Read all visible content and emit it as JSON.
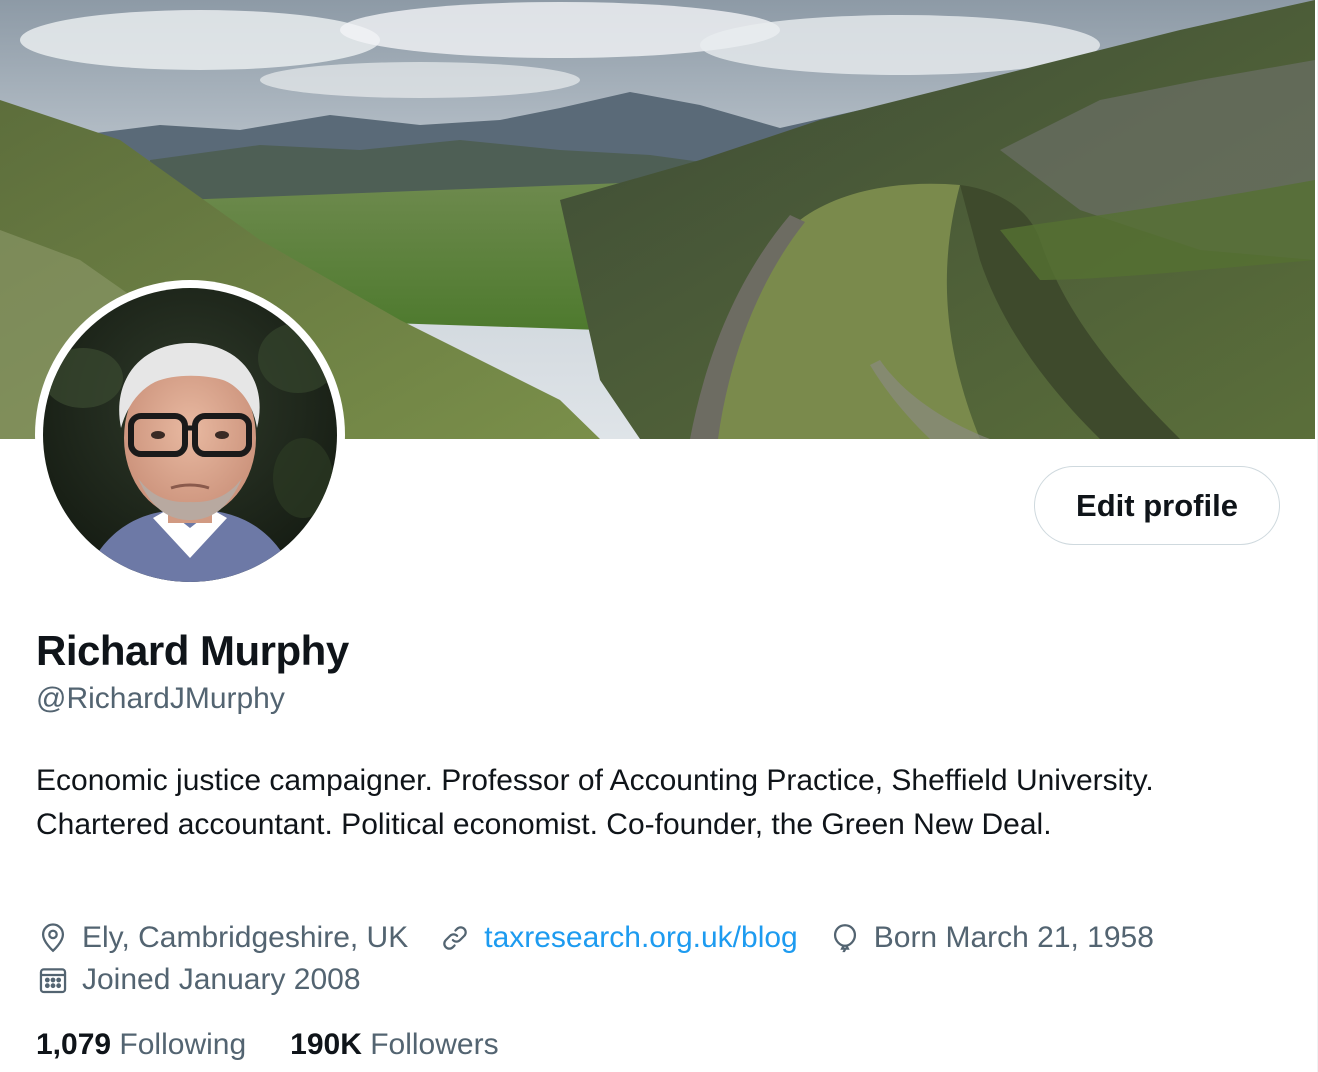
{
  "profile": {
    "name": "Richard Murphy",
    "handle": "@RichardJMurphy",
    "bio": "Economic justice campaigner. Professor of Accounting Practice, Sheffield University. Chartered accountant. Political economist. Co-founder, the Green New Deal.",
    "edit_label": "Edit profile"
  },
  "meta": {
    "location": "Ely, Cambridgeshire, UK",
    "website": "taxresearch.org.uk/blog",
    "birthday": "Born March 21, 1958",
    "joined": "Joined January 2008"
  },
  "stats": {
    "following_count": "1,079",
    "following_label": "Following",
    "followers_count": "190K",
    "followers_label": "Followers"
  },
  "icons": {
    "location": "location-pin-icon",
    "website": "link-icon",
    "birthday": "balloon-icon",
    "joined": "calendar-icon"
  },
  "colors": {
    "link": "#1d9bf0",
    "secondary_text": "#536471",
    "primary_text": "#0f1419"
  }
}
